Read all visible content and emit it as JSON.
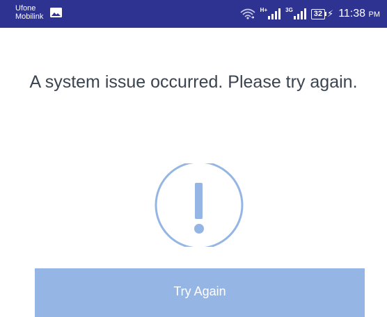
{
  "status_bar": {
    "carrier_1": "Ufone",
    "carrier_2": "Mobilink",
    "sim1_network": "H+",
    "sim2_network": "3G",
    "battery_level": "32",
    "time": "11:38",
    "ampm": "PM",
    "icons": [
      "gallery-icon",
      "wifi-icon",
      "signal-icon",
      "signal-icon",
      "battery-icon",
      "charging-icon"
    ]
  },
  "main": {
    "message": "A system issue occurred. Please try again.",
    "icon": "exclamation-circle-icon",
    "icon_color": "#95b6e4"
  },
  "button": {
    "label": "Try Again",
    "color": "#95b6e4"
  },
  "colors": {
    "status_bar": "#2e3391",
    "text": "#3a4350"
  }
}
